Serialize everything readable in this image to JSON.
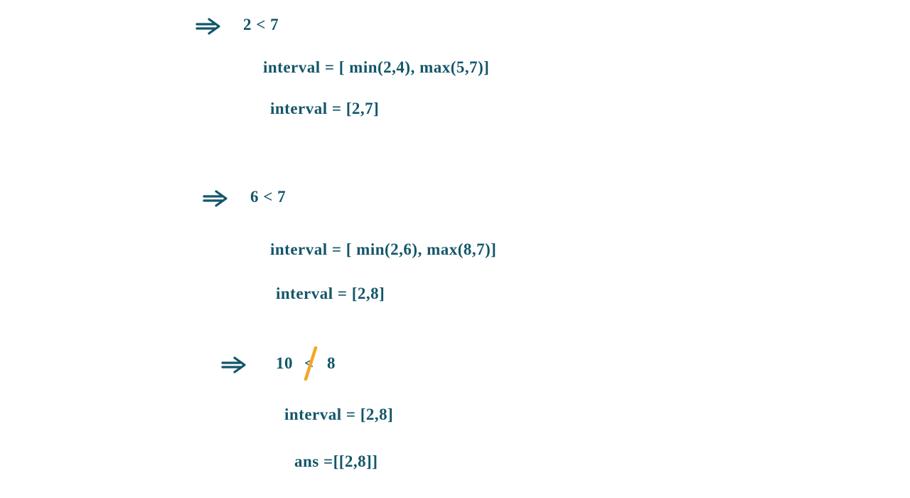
{
  "steps": [
    {
      "condition": "2 < 7",
      "computation": "interval = [ min(2,4), max(5,7)]",
      "result": "interval = [2,7]"
    },
    {
      "condition": "6 < 7",
      "computation": "interval = [ min(2,6), max(8,7)]",
      "result": "interval = [2,8]"
    },
    {
      "condition_left": "10",
      "condition_op": "<",
      "condition_right": "8",
      "condition_negated": true,
      "result": "interval = [2,8]",
      "answer": "ans =[[2,8]]"
    }
  ],
  "colors": {
    "ink": "#13566a",
    "strike": "#f5a623"
  }
}
